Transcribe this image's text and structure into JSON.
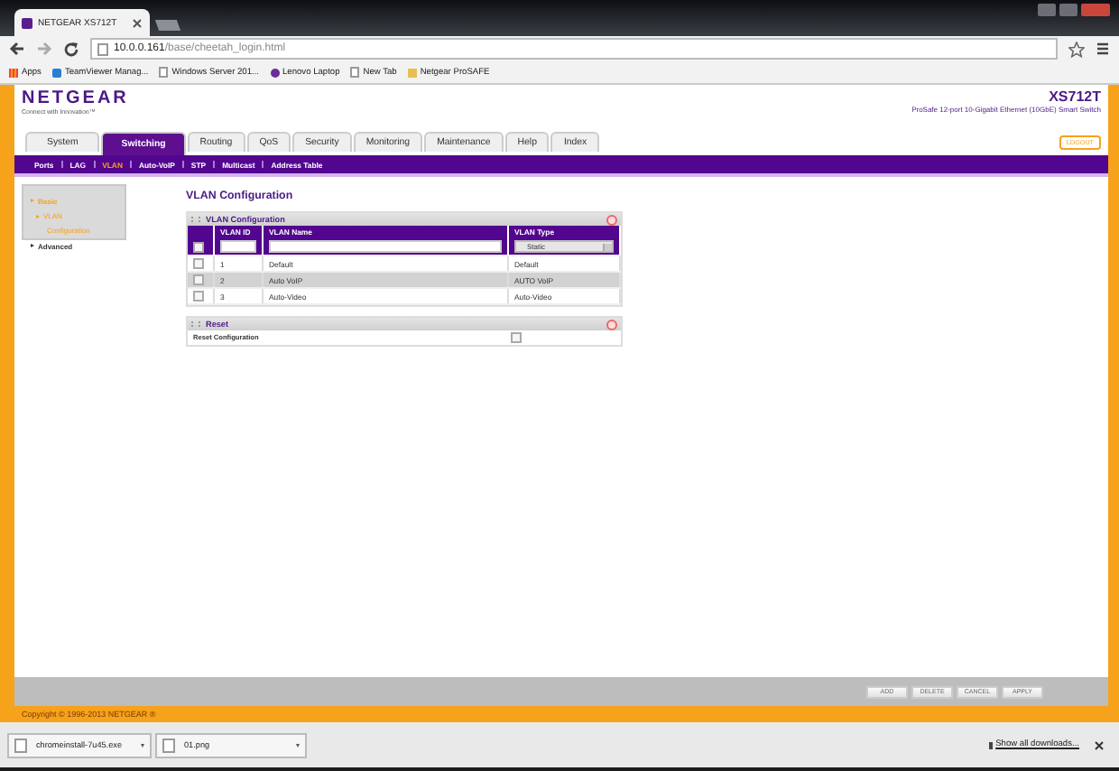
{
  "browser": {
    "tab_title": "NETGEAR XS712T",
    "address_host": "10.0.0.161",
    "address_path": "/base/cheetah_login.html",
    "bookmarks": [
      {
        "label": "Apps",
        "kind": "apps"
      },
      {
        "label": "TeamViewer Manag...",
        "kind": "app"
      },
      {
        "label": "Windows Server 201...",
        "kind": "page"
      },
      {
        "label": "Lenovo Laptop",
        "kind": "peace"
      },
      {
        "label": "New Tab",
        "kind": "page"
      },
      {
        "label": "Netgear ProSAFE",
        "kind": "folder"
      }
    ]
  },
  "header": {
    "logo": "NETGEAR",
    "tagline": "Connect with Innovation™",
    "model": "XS712T",
    "subtitle": "ProSafe 12-port 10-Gigabit Ethernet (10GbE) Smart Switch"
  },
  "tabs": [
    {
      "label": "System",
      "selected": false
    },
    {
      "label": "Switching",
      "selected": true
    },
    {
      "label": "Routing",
      "selected": false
    },
    {
      "label": "QoS",
      "selected": false
    },
    {
      "label": "Security",
      "selected": false
    },
    {
      "label": "Monitoring",
      "selected": false
    },
    {
      "label": "Maintenance",
      "selected": false
    },
    {
      "label": "Help",
      "selected": false
    },
    {
      "label": "Index",
      "selected": false
    }
  ],
  "logout": "LOGOUT",
  "subnav": [
    {
      "label": "Ports",
      "selected": false
    },
    {
      "label": "LAG",
      "selected": false
    },
    {
      "label": "VLAN",
      "selected": true
    },
    {
      "label": "Auto-VoIP",
      "selected": false
    },
    {
      "label": "STP",
      "selected": false
    },
    {
      "label": "Multicast",
      "selected": false
    },
    {
      "label": "Address Table",
      "selected": false
    }
  ],
  "sidebar": [
    {
      "label": "Basic",
      "active": true,
      "children": [
        {
          "label": "VLAN",
          "active": true,
          "children": [
            {
              "label": "Configuration",
              "active": true
            }
          ]
        }
      ]
    },
    {
      "label": "Advanced",
      "active": false
    }
  ],
  "page_title": "VLAN Configuration",
  "vlan_panel": {
    "title": "VLAN Configuration",
    "columns": [
      "VLAN ID",
      "VLAN Name",
      "VLAN Type"
    ],
    "new_entry": {
      "checked": false,
      "type": "Static"
    },
    "rows": [
      {
        "id": "1",
        "name": "Default",
        "type": "Default",
        "checked": false,
        "highlighted": false
      },
      {
        "id": "2",
        "name": "Auto VoIP",
        "type": "AUTO VoIP",
        "checked": false,
        "highlighted": true
      },
      {
        "id": "3",
        "name": "Auto-Video",
        "type": "Auto-Video",
        "checked": false,
        "highlighted": false
      }
    ]
  },
  "reset_panel": {
    "title": "Reset",
    "label": "Reset Configuration",
    "checked": false
  },
  "buttons": [
    "ADD",
    "DELETE",
    "CANCEL",
    "APPLY"
  ],
  "copyright": "Copyright © 1996-2013 NETGEAR ®",
  "downloads": {
    "files": [
      {
        "name": "chromeinstall-7u45.exe"
      },
      {
        "name": "01.png"
      }
    ],
    "show_all": "Show all downloads..."
  }
}
